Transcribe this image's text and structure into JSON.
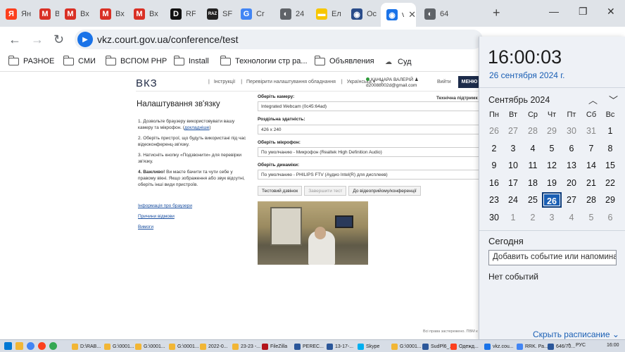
{
  "browser": {
    "tabs": [
      {
        "letter": "Я",
        "title": "Ян",
        "color": "#fc3f1d"
      },
      {
        "letter": "M",
        "title": "Вх",
        "color": "#d93025"
      },
      {
        "letter": "M",
        "title": "Вх",
        "color": "#d93025"
      },
      {
        "letter": "M",
        "title": "Вх",
        "color": "#d93025"
      },
      {
        "letter": "M",
        "title": "Вх",
        "color": "#d93025"
      },
      {
        "letter": "D",
        "title": "RF",
        "color": "#111111"
      },
      {
        "letter": "RAZ",
        "title": "SF",
        "color": "#222222"
      },
      {
        "letter": "G",
        "title": "Cr",
        "color": "#4285f4"
      },
      {
        "letter": "◐",
        "title": "24",
        "color": "#5f6368"
      },
      {
        "letter": "▬",
        "title": "Ел",
        "color": "#f7c600"
      },
      {
        "letter": "◉",
        "title": "Ос",
        "color": "#2a4c8a"
      },
      {
        "letter": "◉",
        "title": "vk",
        "color": "#1a73e8"
      },
      {
        "letter": "◐",
        "title": "64",
        "color": "#5f6368"
      }
    ],
    "active_tab_close": "✕",
    "new_tab": "+",
    "url": "vkz.court.gov.ua/conference/test",
    "bookmarks": [
      {
        "label": "РАЗНОЕ",
        "kind": "folder"
      },
      {
        "label": "СМИ",
        "kind": "folder"
      },
      {
        "label": "ВСПОМ PHP",
        "kind": "folder"
      },
      {
        "label": "Install",
        "kind": "folder"
      },
      {
        "label": "Технологии стр ра...",
        "kind": "folder"
      },
      {
        "label": "Объявления",
        "kind": "folder"
      },
      {
        "label": "Суд",
        "kind": "cloud"
      }
    ]
  },
  "page": {
    "logo": "ВКЗ",
    "nav": [
      "Інструкції",
      "Перевірити налаштування обладнання",
      "Українська ▾"
    ],
    "user_name": "КАНЦАРА ВАЛЕРІЙ",
    "user_email": "d20088002d@gmail.com",
    "logout": "Вийти",
    "menu": "МЕНЮ",
    "title": "Налаштування зв'язку",
    "step1a": "1. Дозвольте браузеру використовувати вашу камеру та мікрофон. (",
    "step1_link": "докладніше",
    "step1b": ")",
    "step2": "2. Оберіть пристрої, що будуть використані під час відеоконференц-зв'язку.",
    "step3": "3. Натисніть кнопку «Подзвонити» для перевірки зв'язку.",
    "step4_bold": "4. Важливо!",
    "step4": " Ви маєте бачити та чути себе у правому вікні. Якщо зображення або звук відсутні, оберіть інші види пристроїв.",
    "link_browser": "Інформація про браузери",
    "link_faq": "Причини відмови",
    "link_req": "Вимоги",
    "support": "Технічна підтримк",
    "camera_label": "Оберіть камеру:",
    "camera_value": "Integrated Webcam (0c45:64ad)",
    "resolution_label": "Роздільна здатність:",
    "resolution_value": "426 x 240",
    "mic_label": "Оберіть мікрофон:",
    "mic_value": "По умолчанию - Микрофон (Realtek High Definition Audio)",
    "speaker_label": "Оберіть динаміки:",
    "speaker_value": "По умолчанию - PHILIPS FTV (Аудио Intel(R) для дисплеев)",
    "btn_test": "Тестовий дзвінок",
    "btn_end": "Завершити тест",
    "btn_join": "До відеоприйому/конференції",
    "footer": "Всі права застережено. ПВМ к"
  },
  "flyout": {
    "time": "16:00:03",
    "date": "26 сентября 2024 г.",
    "month": "Сентябрь 2024",
    "weekdays": [
      "Пн",
      "Вт",
      "Ср",
      "Чт",
      "Пт",
      "Сб",
      "Вс"
    ],
    "weeks": [
      [
        [
          26,
          1
        ],
        [
          27,
          1
        ],
        [
          28,
          1
        ],
        [
          29,
          1
        ],
        [
          30,
          1
        ],
        [
          31,
          1
        ],
        [
          1,
          0
        ]
      ],
      [
        [
          2,
          0
        ],
        [
          3,
          0
        ],
        [
          4,
          0
        ],
        [
          5,
          0
        ],
        [
          6,
          0
        ],
        [
          7,
          0
        ],
        [
          8,
          0
        ]
      ],
      [
        [
          9,
          0
        ],
        [
          10,
          0
        ],
        [
          11,
          0
        ],
        [
          12,
          0
        ],
        [
          13,
          0
        ],
        [
          14,
          0
        ],
        [
          15,
          0
        ]
      ],
      [
        [
          16,
          0
        ],
        [
          17,
          0
        ],
        [
          18,
          0
        ],
        [
          19,
          0
        ],
        [
          20,
          0
        ],
        [
          21,
          0
        ],
        [
          22,
          0
        ]
      ],
      [
        [
          23,
          0
        ],
        [
          24,
          0
        ],
        [
          25,
          0
        ],
        [
          26,
          0
        ],
        [
          27,
          0
        ],
        [
          28,
          0
        ],
        [
          29,
          0
        ]
      ],
      [
        [
          30,
          0
        ],
        [
          1,
          1
        ],
        [
          2,
          1
        ],
        [
          3,
          1
        ],
        [
          4,
          1
        ],
        [
          5,
          1
        ],
        [
          6,
          1
        ]
      ]
    ],
    "today_day": 26,
    "today_label": "Сегодня",
    "add_event_placeholder": "Добавить событие или напоминание",
    "no_events": "Нет событий",
    "hide_schedule": "Скрыть расписание ⌄"
  },
  "taskbar": {
    "items": [
      {
        "label": "D:\\RAB...",
        "color": "#f2b635"
      },
      {
        "label": "G:\\0001...",
        "color": "#f2b635"
      },
      {
        "label": "G:\\0001...",
        "color": "#f2b635"
      },
      {
        "label": "G:\\0001...",
        "color": "#f2b635"
      },
      {
        "label": "2022-0...",
        "color": "#f2b635"
      },
      {
        "label": "23-23 -...",
        "color": "#f2b635"
      },
      {
        "label": "FileZilla",
        "color": "#b3141b"
      },
      {
        "label": "PEREC...",
        "color": "#2b579a"
      },
      {
        "label": "13-17-...",
        "color": "#2b579a"
      },
      {
        "label": "Skype",
        "color": "#00aff0"
      },
      {
        "label": "G:\\0001...",
        "color": "#f2b635"
      },
      {
        "label": "SudPl6_...",
        "color": "#2b579a"
      },
      {
        "label": "Одежд...",
        "color": "#fc3f1d"
      },
      {
        "label": "vkz.cou...",
        "color": "#1a73e8"
      },
      {
        "label": "RRK. Ра...",
        "color": "#4285f4"
      },
      {
        "label": "646/70...",
        "color": "#2b579a"
      }
    ],
    "lang": "РУС",
    "clock": "16:00"
  }
}
